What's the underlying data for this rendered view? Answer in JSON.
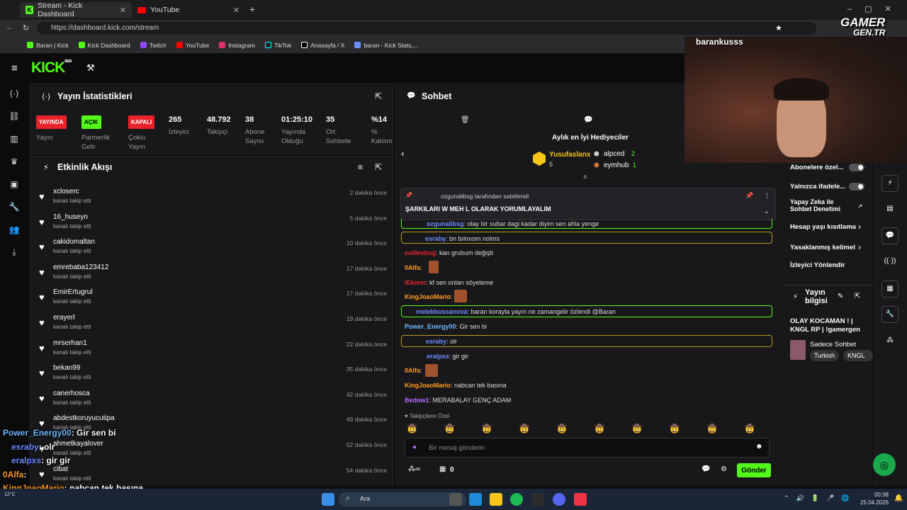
{
  "browser": {
    "tabs": [
      {
        "label": "Stream - Kick Dashboard"
      },
      {
        "label": "YouTube"
      }
    ],
    "url": "https://dashboard.kick.com/stream",
    "bookmarks": [
      "Baran | Kick",
      "Kick Dashboard",
      "Twitch",
      "YouTube",
      "Instagram",
      "TikTok",
      "Anasayfa / X",
      "baran - Kick Stats,..."
    ]
  },
  "app": {
    "logo": "KICK",
    "logo_sup": "BETA"
  },
  "stats": {
    "title": "Yayın İstatistikleri",
    "cols": [
      {
        "badge": "YAYINDA",
        "badge_color": "#e8232b",
        "label": "Yayın"
      },
      {
        "badge": "AÇIK",
        "badge_color": "#53fc18",
        "label": "Partnerlik Gelir"
      },
      {
        "badge": "KAPALI",
        "badge_color": "#e8232b",
        "label": "Çoklu Yayın"
      },
      {
        "value": "265",
        "label": "İzleyici"
      },
      {
        "value": "48.792",
        "label": "Takipçi"
      },
      {
        "value": "38",
        "label": "Abone Sayısı"
      },
      {
        "value": "01:25:10",
        "label": "Yayında Olduğu"
      },
      {
        "value": "35",
        "label": "Ort. Sohbete"
      },
      {
        "value": "%14",
        "label": "% Katılım"
      }
    ]
  },
  "feed": {
    "title": "Etkinlik Akışı",
    "items": [
      {
        "user": "xcloserc",
        "sub": "kanalı takip etti",
        "time": "2 dakika önce"
      },
      {
        "user": "16_huseyn",
        "sub": "kanalı takip etti",
        "time": "5 dakika önce"
      },
      {
        "user": "cakidomaltan",
        "sub": "kanalı takip etti",
        "time": "10 dakika önce"
      },
      {
        "user": "emrebaba123412",
        "sub": "kanalı takip etti",
        "time": "17 dakika önce"
      },
      {
        "user": "EmirErtugrul",
        "sub": "kanalı takip etti",
        "time": "17 dakika önce"
      },
      {
        "user": "erayerl",
        "sub": "kanalı takip etti",
        "time": "19 dakika önce"
      },
      {
        "user": "mrserhan1",
        "sub": "kanalı takip etti",
        "time": "22 dakika önce"
      },
      {
        "user": "bekan99",
        "sub": "kanalı takip etti",
        "time": "35 dakika önce"
      },
      {
        "user": "canerhosca",
        "sub": "kanalı takip etti",
        "time": "42 dakika önce"
      },
      {
        "user": "abdestkoruyucutipa",
        "sub": "kanalı takip etti",
        "time": "49 dakika önce"
      },
      {
        "user": "ahmetkayalover",
        "sub": "kanalı takip etti",
        "time": "52 dakika önce"
      },
      {
        "user": "cibat",
        "sub": "kanalı takip etti",
        "time": "54 dakika önce"
      }
    ]
  },
  "chat": {
    "title": "Sohbet",
    "gifters_title": "Aylık en İyi Hediyeciler",
    "gifters": [
      {
        "name": "Yusufaslanx",
        "count": "5"
      },
      {
        "name": "alpced",
        "count": "2"
      },
      {
        "name": "eymhub",
        "count": "1"
      }
    ],
    "pinned_by": "ozgunalibsg tarafından sabitlendi",
    "pinned_text": "ŞARKILARI W MEH L OLARAK YORUMLAYALIM",
    "messages": [
      {
        "user": "ozgunalibsg",
        "text": ": olay bir subar dagi kadar diyim sen ahla yenge",
        "color": "#6c8cff"
      },
      {
        "user": "esraby",
        "text": ": bn bılmıom nolms",
        "color": "#6c8cff"
      },
      {
        "user": "exillevbug",
        "text": ": kan grubum değişti",
        "color": "#e8232b"
      },
      {
        "user": "0Alfa",
        "text": ":",
        "color": "#ff9a1e"
      },
      {
        "user": "lEkrem",
        "text": ": kf sen onları söyeleme",
        "color": "#e8232b"
      },
      {
        "user": "KingJoaoMario",
        "text": ":",
        "color": "#ff9a1e"
      },
      {
        "user": "melekbossanova",
        "text": ": baran korayla yayın ne zamangelir özlendi @Baran",
        "color": "#6c8cff"
      },
      {
        "user": "Power_Energy00",
        "text": ": Gir sen bi",
        "color": "#6cb8ff"
      },
      {
        "user": "esraby",
        "text": ": olr",
        "color": "#6c8cff"
      },
      {
        "user": "eralpxs",
        "text": ": gir gir",
        "color": "#6c8cff"
      },
      {
        "user": "0Alfa",
        "text": ":",
        "color": "#ff9a1e"
      },
      {
        "user": "KingJoaoMario",
        "text": ": nabcan tek basına",
        "color": "#ff9a1e"
      },
      {
        "user": "Bedow1",
        "text": ": MERABALAY GENÇ ADAM",
        "color": "#b06cff"
      }
    ],
    "followers_label": "Takipçilere Özel",
    "input_placeholder": "Bir mesaj gönderin",
    "count_label": "0",
    "send": "Gönder"
  },
  "webcam": {
    "name": "barankusss"
  },
  "watermark": {
    "line1": "GAMER",
    "line2": "GEN.TR"
  },
  "right": {
    "items": [
      "Abonelere özel...",
      "Yalnızca ifadele...",
      "Yapay Zeka ile Sohbet Denetimi",
      "Hesap yaşı kısıtlama",
      "Yasaklanmış kelimel",
      "İzleyici Yönlendir"
    ],
    "info_title": "Yayın bilgisi",
    "stream_title": "OLAY KOCAMAN ! | KNGL RP | !gamergen",
    "category": "Sadece Sohbet",
    "tags": [
      "Turkish",
      "KNGL"
    ]
  },
  "overlay": [
    {
      "user": "Power_Energy00",
      "text": ": Gir sen bi",
      "color": "#6cb8ff"
    },
    {
      "user": "esraby",
      "text": ": olr",
      "color": "#6c8cff"
    },
    {
      "user": "eralpxs",
      "text": ": gir gir",
      "color": "#6c8cff"
    },
    {
      "user": "0Alfa",
      "text": ":",
      "color": "#ff9a1e"
    },
    {
      "user": "KingJoaoMario",
      "text": ": nabcan tek basına",
      "color": "#ff9a1e"
    },
    {
      "user": "Bedow1",
      "text": ": MERABALAY GENÇ ADAM",
      "color": "#b06cff"
    }
  ],
  "taskbar": {
    "search": "Ara",
    "weather": "12°C",
    "time": "00:38",
    "date": "25.04.2026"
  }
}
